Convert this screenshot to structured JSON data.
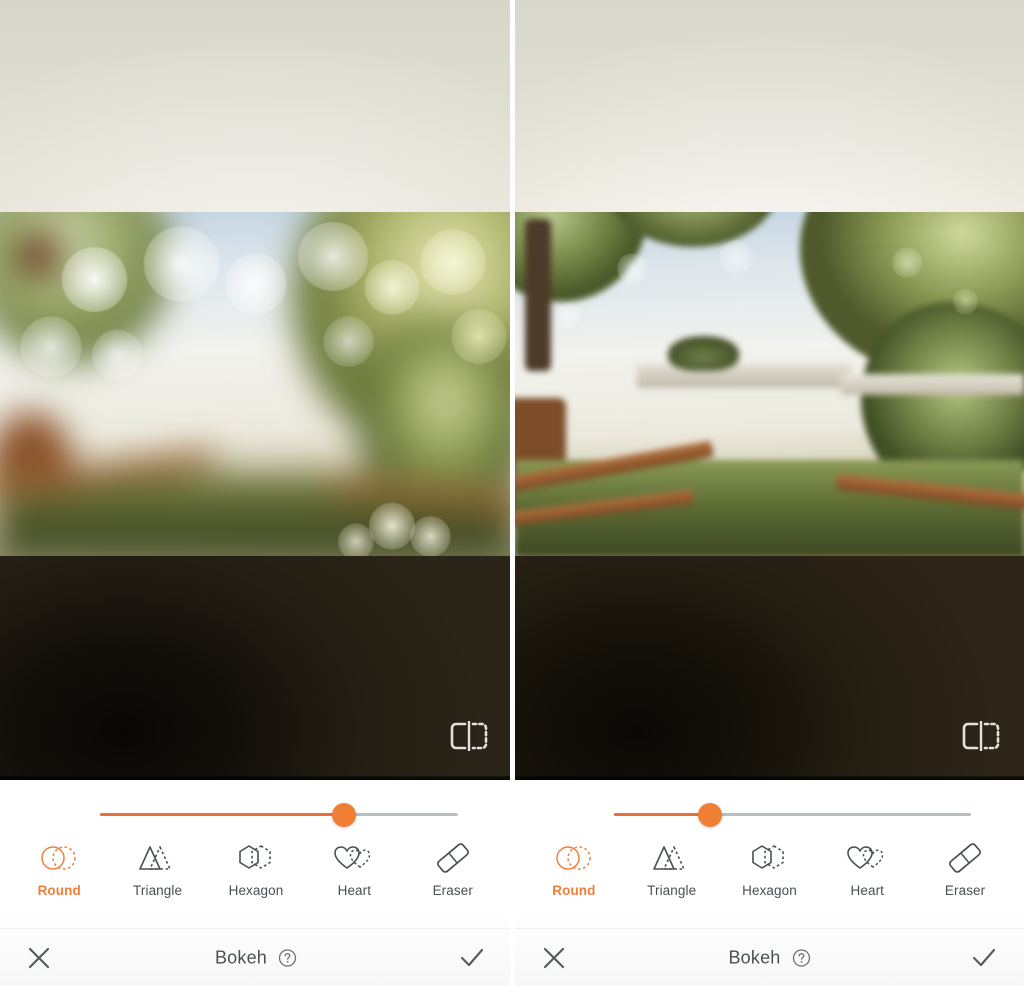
{
  "app": {
    "feature_title": "Bokeh",
    "help_icon": "question-circle-icon",
    "watermark_icon": "app-watermark-icon"
  },
  "panels": [
    {
      "id": "left",
      "slider": {
        "value_percent": 68,
        "fill_color": "#e8703a",
        "thumb_color": "#f07f35",
        "track_color": "#b9c0c4"
      },
      "tools": [
        {
          "label": "Round",
          "icon": "bokeh-shape-round-icon",
          "selected": true
        },
        {
          "label": "Triangle",
          "icon": "bokeh-shape-triangle-icon",
          "selected": false
        },
        {
          "label": "Hexagon",
          "icon": "bokeh-shape-hexagon-icon",
          "selected": false
        },
        {
          "label": "Heart",
          "icon": "bokeh-shape-heart-icon",
          "selected": false
        },
        {
          "label": "Eraser",
          "icon": "eraser-icon",
          "selected": false
        }
      ],
      "actions": {
        "cancel_icon": "close-x-icon",
        "title": "Bokeh",
        "help_icon": "question-circle-icon",
        "confirm_icon": "check-icon"
      }
    },
    {
      "id": "right",
      "slider": {
        "value_percent": 27,
        "fill_color": "#e8703a",
        "thumb_color": "#f07f35",
        "track_color": "#b9c0c4"
      },
      "tools": [
        {
          "label": "Round",
          "icon": "bokeh-shape-round-icon",
          "selected": true
        },
        {
          "label": "Triangle",
          "icon": "bokeh-shape-triangle-icon",
          "selected": false
        },
        {
          "label": "Hexagon",
          "icon": "bokeh-shape-hexagon-icon",
          "selected": false
        },
        {
          "label": "Heart",
          "icon": "bokeh-shape-heart-icon",
          "selected": false
        },
        {
          "label": "Eraser",
          "icon": "eraser-icon",
          "selected": false
        }
      ],
      "actions": {
        "cancel_icon": "close-x-icon",
        "title": "Bokeh",
        "help_icon": "question-circle-icon",
        "confirm_icon": "check-icon"
      }
    }
  ],
  "colors": {
    "accent": "#ef7f3c",
    "accent_track": "#e8703a",
    "label": "#4a4f52",
    "sheet_bg": "#ffffff"
  }
}
